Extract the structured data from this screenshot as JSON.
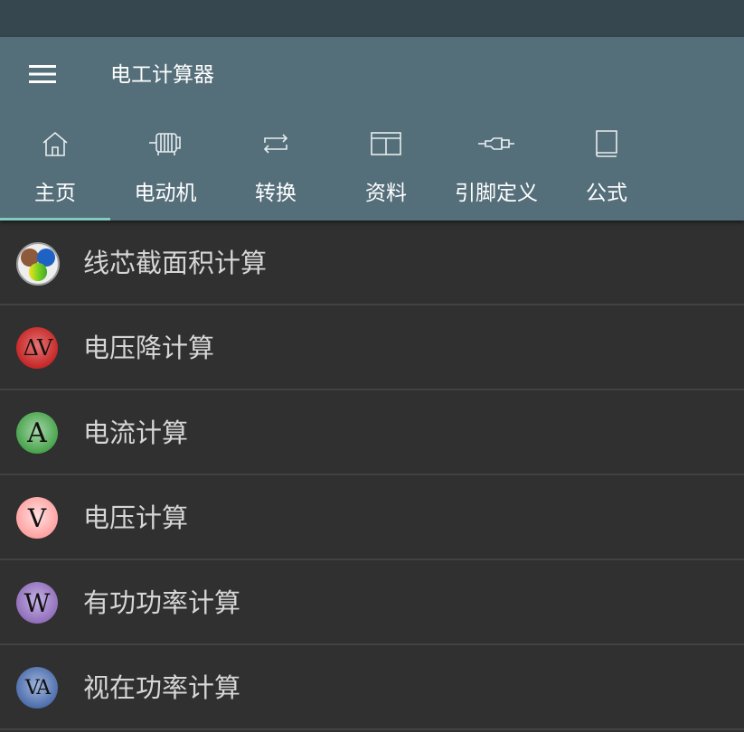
{
  "app": {
    "title": "电工计算器",
    "menu_icon": "hamburger-menu-icon"
  },
  "tabs": [
    {
      "label": "主页",
      "icon": "home-icon",
      "selected": true
    },
    {
      "label": "电动机",
      "icon": "motor-icon",
      "selected": false
    },
    {
      "label": "转换",
      "icon": "swap-icon",
      "selected": false
    },
    {
      "label": "资料",
      "icon": "book-open-icon",
      "selected": false
    },
    {
      "label": "引脚定义",
      "icon": "connector-plug-icon",
      "selected": false
    },
    {
      "label": "公式",
      "icon": "book-icon",
      "selected": false
    }
  ],
  "list": [
    {
      "label": "线芯截面积计算",
      "icon": "wire-cross-section-icon"
    },
    {
      "label": "电压降计算",
      "icon": "voltage-drop-icon",
      "icon_text": "ΔV",
      "icon_color": "#c62828"
    },
    {
      "label": "电流计算",
      "icon": "current-icon",
      "icon_text": "A",
      "icon_color": "#66bb6a"
    },
    {
      "label": "电压计算",
      "icon": "voltage-icon",
      "icon_text": "V",
      "icon_color": "#ffb3b3"
    },
    {
      "label": "有功功率计算",
      "icon": "active-power-icon",
      "icon_text": "W",
      "icon_color": "#9575cd"
    },
    {
      "label": "视在功率计算",
      "icon": "apparent-power-icon",
      "icon_text": "VA",
      "icon_color": "#5c7fb8"
    }
  ],
  "colors": {
    "status_bar": "#37474f",
    "app_bar": "#546e7a",
    "background": "#303030",
    "tab_indicator": "#80cbc4"
  }
}
